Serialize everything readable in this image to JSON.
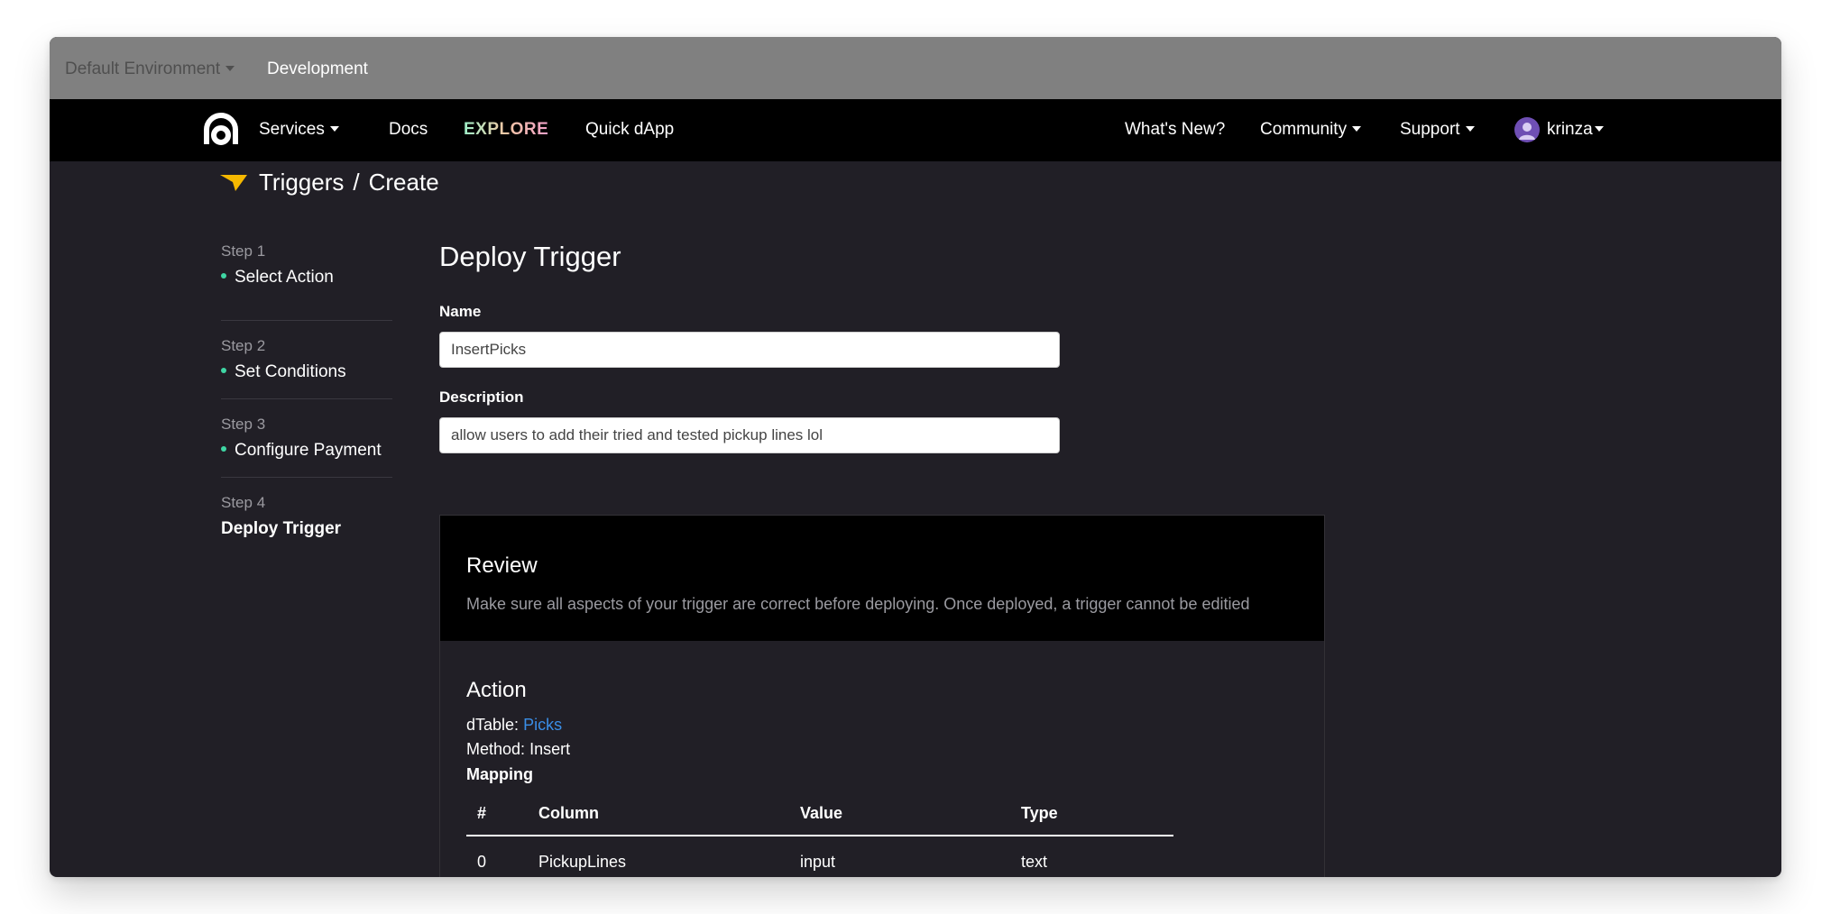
{
  "env_bar": {
    "environment_select": "Default Environment",
    "current": "Development"
  },
  "nav": {
    "logo_icon": "appbase-a-logo",
    "services": "Services",
    "docs": "Docs",
    "explore": "EXPLORE",
    "quick_dapp": "Quick dApp",
    "whats_new": "What's New?",
    "community": "Community",
    "support": "Support",
    "user": "krinza",
    "avatar_icon": "user-avatar-icon"
  },
  "breadcrumb": {
    "icon": "trigger-arrow-icon",
    "section": "Triggers",
    "separator": "/",
    "page": "Create"
  },
  "steps": [
    {
      "number": "Step 1",
      "label": "Select Action",
      "done": true
    },
    {
      "number": "Step 2",
      "label": "Set Conditions",
      "done": true
    },
    {
      "number": "Step 3",
      "label": "Configure Payment",
      "done": true
    },
    {
      "number": "Step 4",
      "label": "Deploy Trigger",
      "done": false
    }
  ],
  "form": {
    "title": "Deploy Trigger",
    "name_label": "Name",
    "name_value": "InsertPicks",
    "description_label": "Description",
    "description_value": "allow users to add their tried and tested pickup lines lol"
  },
  "review": {
    "title": "Review",
    "description": "Make sure all aspects of your trigger are correct before deploying. Once deployed, a trigger cannot be editied"
  },
  "action": {
    "title": "Action",
    "dtable_label": "dTable:",
    "dtable_value": "Picks",
    "method_label": "Method:",
    "method_value": "Insert",
    "mapping_label": "Mapping",
    "columns": [
      "#",
      "Column",
      "Value",
      "Type"
    ],
    "rows": [
      [
        "0",
        "PickupLines",
        "input",
        "text"
      ]
    ]
  },
  "colors": {
    "accent_dot": "#3fd6a4",
    "link": "#3a8ee6",
    "trigger_icon": "#f5b800",
    "avatar": "#6f4fb4"
  }
}
